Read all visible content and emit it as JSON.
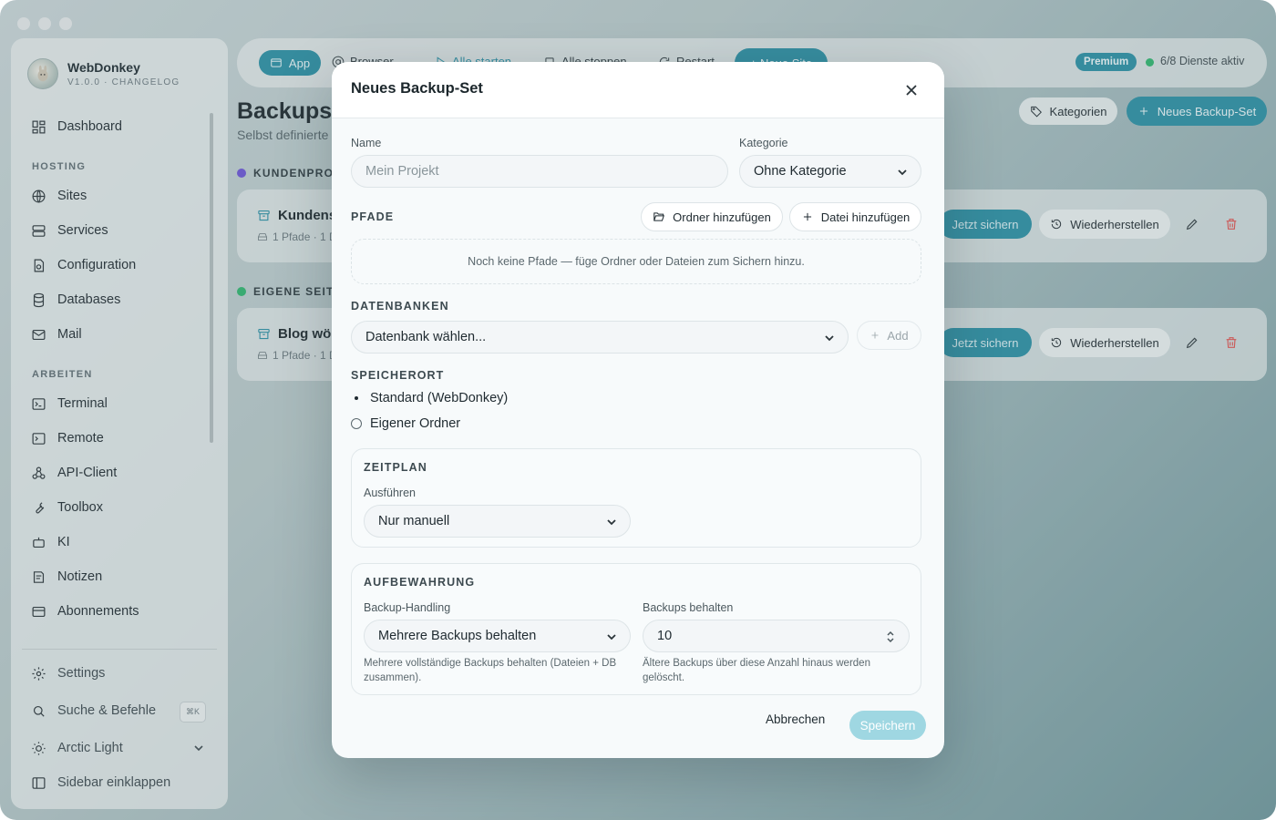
{
  "sidebar": {
    "brand_name": "WebDonkey",
    "brand_sub": "V1.0.0 · CHANGELOG",
    "dashboard": "Dashboard",
    "section_hosting": "HOSTING",
    "sites": "Sites",
    "services": "Services",
    "configuration": "Configuration",
    "databases": "Databases",
    "mail": "Mail",
    "section_arbeiten": "ARBEITEN",
    "terminal": "Terminal",
    "remote": "Remote",
    "api_client": "API-Client",
    "toolbox": "Toolbox",
    "ki": "KI",
    "notizen": "Notizen",
    "abonnements": "Abonnements",
    "settings": "Settings",
    "search": "Suche & Befehle",
    "search_shortcut": "⌘K",
    "theme": "Arctic Light",
    "collapse": "Sidebar einklappen"
  },
  "topbar": {
    "app": "App",
    "browser": "Browser",
    "alle_starten": "Alle starten",
    "alle_stoppen": "Alle stoppen",
    "restart": "Restart",
    "neue_site": "+ Neue Site",
    "premium": "Premium",
    "status": "6/8 Dienste aktiv"
  },
  "page": {
    "title": "Backups",
    "subtitle": "Selbst definierte",
    "kategorien": "Kategorien",
    "new_set": "Neues Backup-Set",
    "group1": "KUNDENPROJ",
    "group2": "EIGENE SEITE",
    "card1_title": "Kundens",
    "card1_meta": "1 Pfade · 1 D",
    "card2_title": "Blog wöc",
    "card2_meta": "1 Pfade · 1 D",
    "jetzt_sichern": "Jetzt sichern",
    "wiederherstellen": "Wiederherstellen"
  },
  "modal": {
    "title": "Neues Backup-Set",
    "name_label": "Name",
    "name_placeholder": "Mein Projekt",
    "kategorie_label": "Kategorie",
    "kategorie_value": "Ohne Kategorie",
    "pfade_label": "PFADE",
    "add_folder": "Ordner hinzufügen",
    "add_file": "Datei hinzufügen",
    "empty_paths": "Noch keine Pfade — füge Ordner oder Dateien zum Sichern hinzu.",
    "db_label": "DATENBANKEN",
    "db_select": "Datenbank wählen...",
    "db_add": "Add",
    "speicherort_label": "SPEICHERORT",
    "opt_standard": "Standard (WebDonkey)",
    "opt_custom": "Eigener Ordner",
    "zeitplan_label": "ZEITPLAN",
    "ausfuehren_label": "Ausführen",
    "ausfuehren_value": "Nur manuell",
    "aufbewahrung_label": "AUFBEWAHRUNG",
    "handling_label": "Backup-Handling",
    "handling_value": "Mehrere Backups behalten",
    "handling_hint": "Mehrere vollständige Backups behalten (Dateien + DB zusammen).",
    "keep_label": "Backups behalten",
    "keep_value": "10",
    "keep_hint": "Ältere Backups über diese Anzahl hinaus werden gelöscht.",
    "cancel": "Abbrechen",
    "save": "Speichern"
  },
  "colors": {
    "accent": "#2a8fa4",
    "save_disabled": "#9fd7e2",
    "danger": "#e0514f",
    "status_ok": "#2fb56e"
  }
}
